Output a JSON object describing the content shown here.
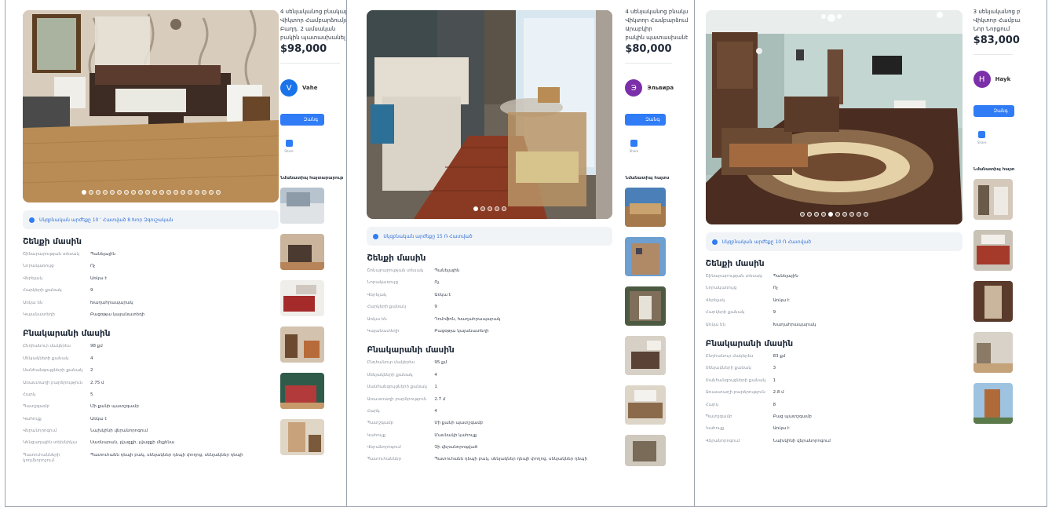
{
  "panels": [
    {
      "title_lines": [
        "4 սենյականոց բնակարան վաճառքի",
        "Վիկտոր Համբարձումյան",
        "Բաղդ. 2 ամսական",
        "բակին պատասխանել"
      ],
      "price": "$98,000",
      "seller": {
        "initial": "V",
        "name": "Vahe",
        "color": "#1a73e8"
      },
      "call_label": "Զանգ",
      "share_label": "Share",
      "banner": "Սկզբնական արժեքը 10 ՙ Հատված 8 Խոր Զգուշական",
      "building_title": "Շենքի մասին",
      "building_rows": [
        {
          "k": "Շինարարության տեսակ",
          "v": "Պանելային"
        },
        {
          "k": "Նորակառույց",
          "v": "Ոչ"
        },
        {
          "k": "Վերելակ",
          "v": "Առկա է"
        },
        {
          "k": "Հարկերի քանակ",
          "v": "9"
        },
        {
          "k": "Առկա են",
          "v": "Խաղահրապարակ"
        },
        {
          "k": "Կայանատեղի",
          "v": "Բացօթյա կայանատեղի"
        }
      ],
      "apt_title": "Բնակարանի մասին",
      "apt_rows": [
        {
          "k": "Ընդհանուր մակերես",
          "v": "98 քմ"
        },
        {
          "k": "Սենյակների քանակ",
          "v": "4"
        },
        {
          "k": "Սանհանգույցների քանակ",
          "v": "2"
        },
        {
          "k": "Առաստաղի բարձրություն",
          "v": "2.75 մ"
        },
        {
          "k": "Հարկ",
          "v": "5"
        },
        {
          "k": "Պատշգամբ",
          "v": "Մի քանի պատշգամբ"
        },
        {
          "k": "Կահույք",
          "v": "Առկա է"
        },
        {
          "k": "Վերանորոգում",
          "v": "Նախկինի վերանորոգում"
        },
        {
          "k": "Կենցաղային տեխնիկա",
          "v": "Սառնարան, լվացքի, լվացքի մեքենա"
        },
        {
          "k": "Պատուհանների կողմնորոշում",
          "v": "Պատուհանն դեպի բակ, սենյակներ դեպի փողոց, սենյակներ դեպի"
        }
      ],
      "similar_title": "Նմանատիպ հայտարարություններ",
      "dots": 20,
      "active_dot": 0
    },
    {
      "title_lines": [
        "4 սենյականոց բնակարան",
        "Վիկտոր Համբարձումյան",
        "Արաբկիր",
        "բակին պատասխանել"
      ],
      "price": "$80,000",
      "seller": {
        "initial": "Э",
        "name": "Эльвира",
        "color": "#7b2fa8"
      },
      "call_label": "Զանգ",
      "share_label": "Share",
      "banner": "Սկզբնական արժեքը 15 Ռ Հատված",
      "building_title": "Շենքի մասին",
      "building_rows": [
        {
          "k": "Շինարարության տեսակ",
          "v": "Պանելային"
        },
        {
          "k": "Նորակառույց",
          "v": "Ոչ"
        },
        {
          "k": "Վերելակ",
          "v": "Առկա է"
        },
        {
          "k": "Հարկերի քանակ",
          "v": "9"
        },
        {
          "k": "Առկա են",
          "v": "Դոմոֆոն, Խաղահրապարակ"
        },
        {
          "k": "Կայանատեղի",
          "v": "Բացօթյա կայանատեղի"
        }
      ],
      "apt_title": "Բնակարանի մասին",
      "apt_rows": [
        {
          "k": "Ընդհանուր մակերես",
          "v": "95 քմ"
        },
        {
          "k": "Սենյակների քանակ",
          "v": "4"
        },
        {
          "k": "Սանհանգույցների քանակ",
          "v": "1"
        },
        {
          "k": "Առաստաղի բարձրություն",
          "v": "2.7 մ"
        },
        {
          "k": "Հարկ",
          "v": "4"
        },
        {
          "k": "Պատշգամբ",
          "v": "Մի քանի պատշգամբ"
        },
        {
          "k": "Կահույք",
          "v": "Մասնակի կահույք"
        },
        {
          "k": "Վերանորոգում",
          "v": "Չի վերանորոգված"
        },
        {
          "k": "Պատուհաններ",
          "v": "Պատուհանն դեպի բակ, սենյակներ դեպի փողոց, սենյակներ դեպի"
        }
      ],
      "dots": 5,
      "active_dot": 0
    },
    {
      "title_lines": [
        "3 սենյականոց բնակարան",
        "Վիկտոր Համբարձումյան",
        "Նոր Նորքում"
      ],
      "price": "$83,000",
      "seller": {
        "initial": "H",
        "name": "Hayk",
        "color": "#7b2fa8"
      },
      "call_label": "Զանգ",
      "share_label": "Share",
      "banner": "Սկզբնական արժեքը 10 Ռ Հատված",
      "building_title": "Շենքի մասին",
      "building_rows": [
        {
          "k": "Շինարարության տեսակ",
          "v": "Պանելային"
        },
        {
          "k": "Նորակառույց",
          "v": "Ոչ"
        },
        {
          "k": "Վերելակ",
          "v": "Առկա է"
        },
        {
          "k": "Հարկերի քանակ",
          "v": "9"
        },
        {
          "k": "Առկա են",
          "v": "Խաղահրապարակ"
        }
      ],
      "apt_title": "Բնակարանի մասին",
      "apt_rows": [
        {
          "k": "Ընդհանուր մակերես",
          "v": "83 քմ"
        },
        {
          "k": "Սենյակների քանակ",
          "v": "3"
        },
        {
          "k": "Սանհանգույցների քանակ",
          "v": "1"
        },
        {
          "k": "Առաստաղի բարձրություն",
          "v": "2.8 մ"
        },
        {
          "k": "Հարկ",
          "v": "8"
        },
        {
          "k": "Պատշգամբ",
          "v": "Բաց պատշգամբ"
        },
        {
          "k": "Կահույք",
          "v": "Առկա է"
        },
        {
          "k": "Վերանորոգում",
          "v": "Նախկինի վերանորոգում"
        }
      ],
      "similar_title": "Նմանատիպ հայտարարություններ",
      "dots": 10,
      "active_dot": 4
    }
  ]
}
